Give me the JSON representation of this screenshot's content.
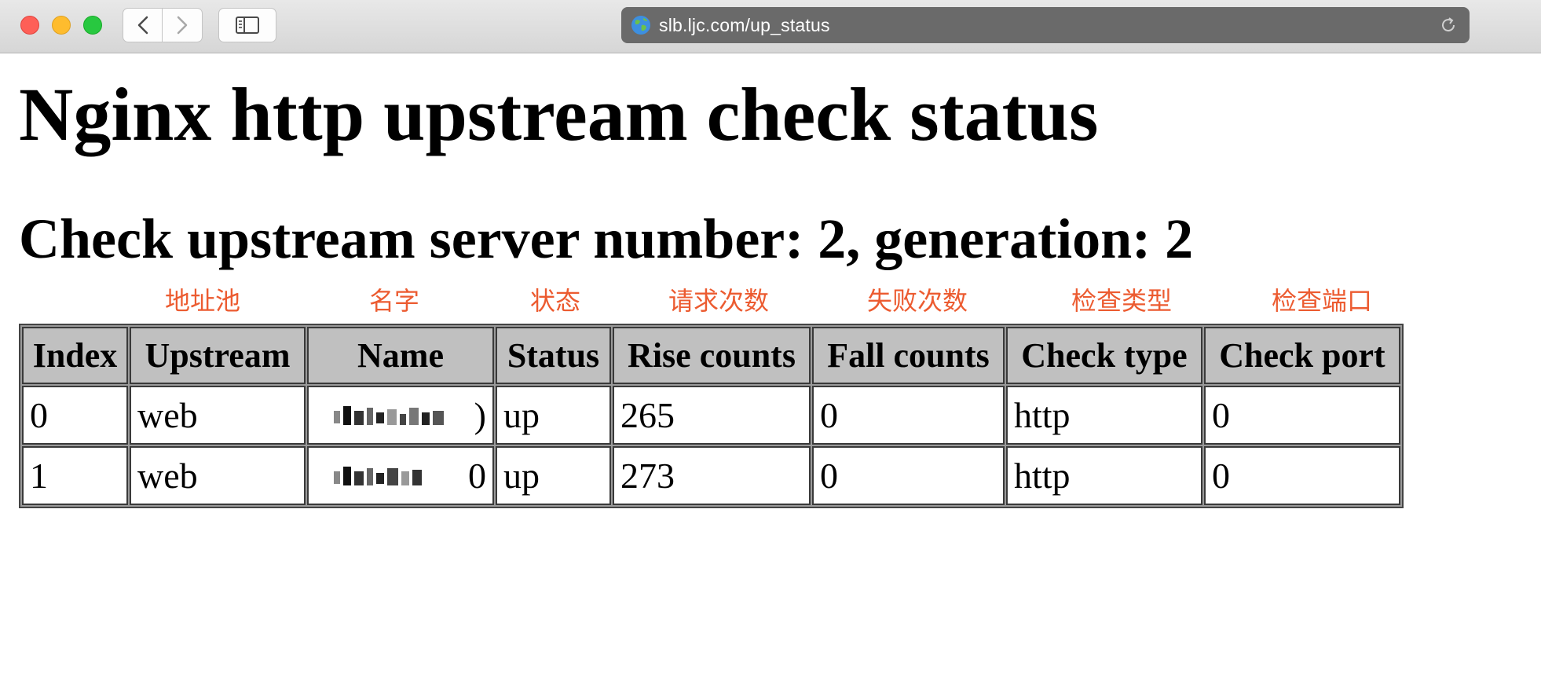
{
  "browser": {
    "url": "slb.ljc.com/up_status",
    "back_icon": "chevron-left-icon",
    "forward_icon": "chevron-right-icon",
    "sidebar_icon": "sidebar-icon",
    "site_icon": "globe-icon",
    "reload_icon": "reload-icon"
  },
  "page": {
    "title": "Nginx http upstream check status",
    "subtitle": "Check upstream server number: 2, generation: 2"
  },
  "annotations": [
    "地址池",
    "名字",
    "状态",
    "请求次数",
    "失败次数",
    "检查类型",
    "检查端口"
  ],
  "colors": {
    "annotation": "#ec5b30",
    "header_bg": "#c0c0c0",
    "address_bar": "#6a6a6a"
  },
  "table": {
    "headers": [
      "Index",
      "Upstream",
      "Name",
      "Status",
      "Rise counts",
      "Fall counts",
      "Check type",
      "Check port"
    ],
    "rows": [
      {
        "index": "0",
        "upstream": "web",
        "name_tail": ")",
        "status": "up",
        "rise": "265",
        "fall": "0",
        "type": "http",
        "port": "0"
      },
      {
        "index": "1",
        "upstream": "web",
        "name_tail": "0",
        "status": "up",
        "rise": "273",
        "fall": "0",
        "type": "http",
        "port": "0"
      }
    ]
  }
}
